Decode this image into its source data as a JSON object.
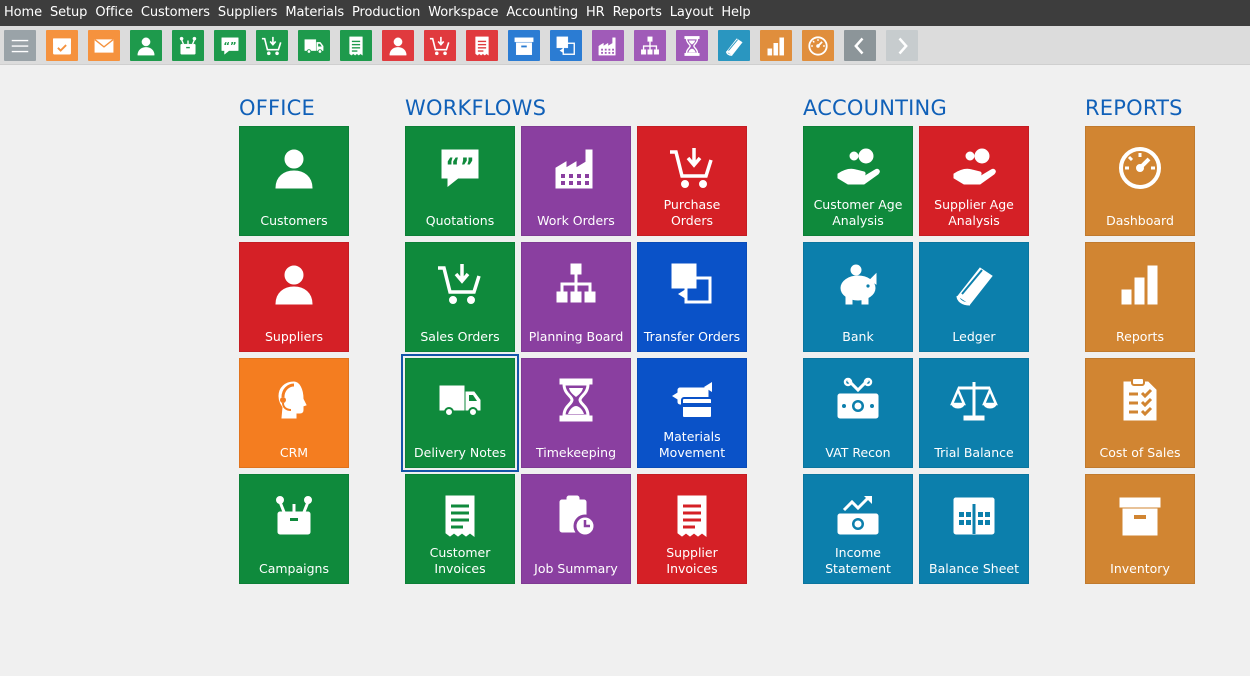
{
  "menu": [
    "Home",
    "Setup",
    "Office",
    "Customers",
    "Suppliers",
    "Materials",
    "Production",
    "Workspace",
    "Accounting",
    "HR",
    "Reports",
    "Layout",
    "Help"
  ],
  "toolbar": [
    {
      "name": "menu",
      "color": "#9aa3a8"
    },
    {
      "name": "calendar",
      "color": "#f5923e"
    },
    {
      "name": "mail",
      "color": "#f5923e"
    },
    {
      "name": "customer",
      "color": "#1e9a4c"
    },
    {
      "name": "campaign",
      "color": "#1e9a4c"
    },
    {
      "name": "quote",
      "color": "#1e9a4c"
    },
    {
      "name": "cart-down",
      "color": "#1e9a4c"
    },
    {
      "name": "truck",
      "color": "#1e9a4c"
    },
    {
      "name": "invoice",
      "color": "#1e9a4c"
    },
    {
      "name": "supplier",
      "color": "#e03a3e"
    },
    {
      "name": "cart-down",
      "color": "#e03a3e"
    },
    {
      "name": "invoice",
      "color": "#e03a3e"
    },
    {
      "name": "inventory",
      "color": "#2b7cd3"
    },
    {
      "name": "transfer",
      "color": "#2b7cd3"
    },
    {
      "name": "factory",
      "color": "#a05bb8"
    },
    {
      "name": "org",
      "color": "#a05bb8"
    },
    {
      "name": "hourglass",
      "color": "#a05bb8"
    },
    {
      "name": "book",
      "color": "#2a96c0"
    },
    {
      "name": "bars",
      "color": "#e08e3c"
    },
    {
      "name": "gauge",
      "color": "#e08e3c"
    },
    {
      "name": "back",
      "color": "#8c9599"
    },
    {
      "name": "forward",
      "color": "#c7ccce"
    }
  ],
  "sections": {
    "office": "OFFICE",
    "workflows": "WORKFLOWS",
    "accounting": "ACCOUNTING",
    "reports": "REPORTS"
  },
  "tiles": {
    "customers": {
      "label": "Customers",
      "icon": "person",
      "color": "#0f8a3c"
    },
    "suppliers": {
      "label": "Suppliers",
      "icon": "person",
      "color": "#d52026"
    },
    "crm": {
      "label": "CRM",
      "icon": "headset",
      "color": "#f47d20"
    },
    "campaigns": {
      "label": "Campaigns",
      "icon": "campaign",
      "color": "#0f8a3c"
    },
    "quotations": {
      "label": "Quotations",
      "icon": "quote",
      "color": "#0f8a3c"
    },
    "work_orders": {
      "label": "Work Orders",
      "icon": "factory",
      "color": "#8a3fa0"
    },
    "purchase_orders": {
      "label": "Purchase Orders",
      "icon": "cart-down",
      "color": "#d52026"
    },
    "sales_orders": {
      "label": "Sales Orders",
      "icon": "cart-down",
      "color": "#0f8a3c"
    },
    "planning_board": {
      "label": "Planning Board",
      "icon": "org",
      "color": "#8a3fa0"
    },
    "transfer_orders": {
      "label": "Transfer Orders",
      "icon": "transfer",
      "color": "#0a52c8"
    },
    "delivery_notes": {
      "label": "Delivery Notes",
      "icon": "truck",
      "color": "#0f8a3c"
    },
    "timekeeping": {
      "label": "Timekeeping",
      "icon": "hourglass",
      "color": "#8a3fa0"
    },
    "materials_movement": {
      "label": "Materials\nMovement",
      "icon": "cards",
      "color": "#0a52c8"
    },
    "customer_invoices": {
      "label": "Customer\nInvoices",
      "icon": "invoice",
      "color": "#0f8a3c"
    },
    "job_summary": {
      "label": "Job Summary",
      "icon": "clipboard-clock",
      "color": "#8a3fa0"
    },
    "supplier_invoices": {
      "label": "Supplier Invoices",
      "icon": "invoice",
      "color": "#d52026"
    },
    "customer_age": {
      "label": "Customer Age\nAnalysis",
      "icon": "hand-coin",
      "color": "#0f8a3c"
    },
    "supplier_age": {
      "label": "Supplier Age\nAnalysis",
      "icon": "hand-coin",
      "color": "#d52026"
    },
    "bank": {
      "label": "Bank",
      "icon": "piggy",
      "color": "#0c7fac"
    },
    "ledger": {
      "label": "Ledger",
      "icon": "book",
      "color": "#0c7fac"
    },
    "vat_recon": {
      "label": "VAT Recon",
      "icon": "cash-cut",
      "color": "#0c7fac"
    },
    "trial_balance": {
      "label": "Trial Balance",
      "icon": "scales",
      "color": "#0c7fac"
    },
    "income_statement": {
      "label": "Income\nStatement",
      "icon": "cash-up",
      "color": "#0c7fac"
    },
    "balance_sheet": {
      "label": "Balance Sheet",
      "icon": "sheet",
      "color": "#0c7fac"
    },
    "dashboard": {
      "label": "Dashboard",
      "icon": "gauge",
      "color": "#d18532"
    },
    "reports": {
      "label": "Reports",
      "icon": "bars",
      "color": "#d18532"
    },
    "cost_of_sales": {
      "label": "Cost of Sales",
      "icon": "checklist",
      "color": "#d18532"
    },
    "inventory": {
      "label": "Inventory",
      "icon": "inventory",
      "color": "#d18532"
    }
  }
}
